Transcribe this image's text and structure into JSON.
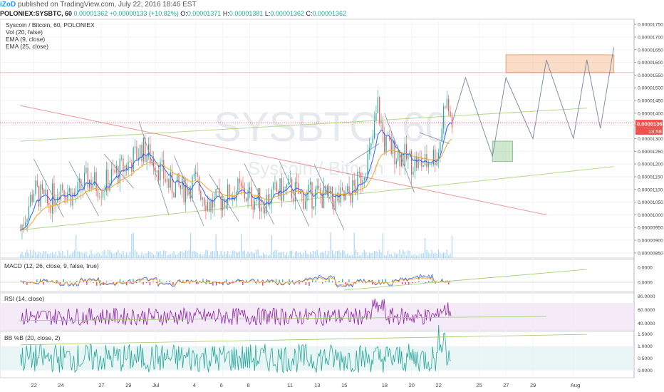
{
  "header": {
    "brand": "iZoD",
    "published": "published on TradingView.com, July 22, 2016 18:46 EST"
  },
  "quote": {
    "symbol": "POLONIEX:SYSBTC, 60",
    "last": "0.00001362",
    "change": "+0.00000133 (+10.82%)",
    "open_label": "O:",
    "open": "0.00001371",
    "high_label": "H:",
    "high": "0.00001381",
    "low_label": "L:",
    "low": "0.00001362",
    "close_label": "C:",
    "close": "0.00001362"
  },
  "legend": {
    "title": "Syscoin / Bitcoin, 60, POLONIEX",
    "vol": "Vol (20, false)",
    "ema9": "EMA (9, close)",
    "ema25": "EMA (25, close)"
  },
  "watermark": {
    "symbol": "SYSBTC, 60",
    "name": "Syscoin / Bitcoin"
  },
  "price_badge": {
    "price": "0.00001362",
    "countdown": "13:58"
  },
  "panes": {
    "macd": "MACD (12, 26, close, 9, false, true)",
    "rsi": "RSI (14, close)",
    "bb": "BB %B (20, close, 2)"
  },
  "colors": {
    "candle_up": "#26a69a",
    "candle_down": "#ef5350",
    "ema9": "#2962ff",
    "ema25": "#f6a623",
    "projection": "#7e8ea8",
    "channel_green": "#9ccc65",
    "channel_red": "#e57373",
    "target_box": "#f4b183",
    "support_box": "#a5d6a7",
    "rsi": "#8e24aa",
    "bb": "#26a69a"
  },
  "chart_data": {
    "type": "line",
    "symbol": "POLONIEX:SYSBTC",
    "interval": "60",
    "x_tick_labels": [
      "22",
      "24",
      "27",
      "29",
      "Jul",
      "4",
      "6",
      "8",
      "11",
      "13",
      "15",
      "18",
      "20",
      "22",
      "25",
      "27",
      "29",
      "Aug"
    ],
    "price_axis": {
      "ticks": [
        "0.00001750",
        "0.00001700",
        "0.00001650",
        "0.00001600",
        "0.00001550",
        "0.00001500",
        "0.00001450",
        "0.00001400",
        "0.00001350",
        "0.00001300",
        "0.00001250",
        "0.00001200",
        "0.00001150",
        "0.00001100",
        "0.00001050",
        "0.00001000",
        "0.00000950",
        "0.00000900",
        "0.00000850"
      ],
      "ylim": [
        8.3e-06,
        1.77e-05
      ]
    },
    "price_series": [
      {
        "day": 21,
        "close": 9.4e-06
      },
      {
        "day": 22,
        "close": 1.1e-05
      },
      {
        "day": 23,
        "close": 1.04e-05
      },
      {
        "day": 24,
        "close": 1.12e-05
      },
      {
        "day": 25,
        "close": 1.07e-05
      },
      {
        "day": 26,
        "close": 1.14e-05
      },
      {
        "day": 27,
        "close": 1.11e-05
      },
      {
        "day": 28,
        "close": 1.16e-05
      },
      {
        "day": 29,
        "close": 1.2e-05
      },
      {
        "day": 30,
        "close": 1.26e-05
      },
      {
        "day": 31,
        "close": 1.21e-05
      },
      {
        "day": 32,
        "close": 1.12e-05
      },
      {
        "day": 33,
        "close": 1.1e-05
      },
      {
        "day": 34,
        "close": 1.13e-05
      },
      {
        "day": 35,
        "close": 1.04e-05
      },
      {
        "day": 36,
        "close": 1.06e-05
      },
      {
        "day": 37,
        "close": 1.1e-05
      },
      {
        "day": 38,
        "close": 1.07e-05
      },
      {
        "day": 39,
        "close": 1.05e-05
      },
      {
        "day": 40,
        "close": 1.09e-05
      },
      {
        "day": 41,
        "close": 1.1e-05
      },
      {
        "day": 42,
        "close": 1.07e-05
      },
      {
        "day": 43,
        "close": 1.08e-05
      },
      {
        "day": 44,
        "close": 1.06e-05
      },
      {
        "day": 45,
        "close": 1.06e-05
      },
      {
        "day": 46,
        "close": 1.12e-05
      },
      {
        "day": 47,
        "close": 1.25e-05
      },
      {
        "day": 47.5,
        "close": 1.43e-05
      },
      {
        "day": 48,
        "close": 1.28e-05
      },
      {
        "day": 49,
        "close": 1.24e-05
      },
      {
        "day": 50,
        "close": 1.21e-05
      },
      {
        "day": 51,
        "close": 1.2e-05
      },
      {
        "day": 52,
        "close": 1.25e-05
      },
      {
        "day": 52.5,
        "close": 1.46e-05
      },
      {
        "day": 53,
        "close": 1.36e-05
      }
    ],
    "projection_path": [
      {
        "day": 53,
        "price": 1.36e-05
      },
      {
        "day": 54,
        "price": 1.54e-05
      },
      {
        "day": 56,
        "price": 1.23e-05
      },
      {
        "day": 57,
        "price": 1.54e-05
      },
      {
        "day": 59,
        "price": 1.3e-05
      },
      {
        "day": 60,
        "price": 1.61e-05
      },
      {
        "day": 62,
        "price": 1.3e-05
      },
      {
        "day": 63,
        "price": 1.61e-05
      },
      {
        "day": 64,
        "price": 1.34e-05
      },
      {
        "day": 65,
        "price": 1.66e-05
      }
    ],
    "zones": {
      "target": {
        "from_day": 57,
        "to_day": 65,
        "low": 1.56e-05,
        "high": 1.63e-05
      },
      "support": {
        "from_day": 56,
        "to_day": 57.5,
        "low": 1.21e-05,
        "high": 1.29e-05
      }
    },
    "channel_lines": [
      {
        "name": "lower-trend",
        "from_day": 21,
        "from_price": 9.4e-06,
        "to_day": 65,
        "to_price": 1.19e-05
      },
      {
        "name": "upper-trend",
        "from_day": 21,
        "from_price": 1.29e-05,
        "to_day": 63,
        "to_price": 1.42e-05
      },
      {
        "name": "resistance-descending",
        "from_day": 21,
        "from_price": 1.43e-05,
        "to_day": 60,
        "to_price": 1e-05
      }
    ],
    "last_price": 1.362e-05,
    "macd": {
      "ticks": [
        "0.0000",
        "0.0000"
      ],
      "values": [
        0,
        0.2,
        -0.3,
        0.4,
        -0.2,
        0.1,
        0.5,
        -0.4,
        0.2,
        0.0,
        -0.1,
        0.3,
        0.1,
        -0.2,
        0.4,
        0.9,
        -0.5,
        0.2,
        -0.3,
        0.6,
        1.0,
        0.3
      ]
    },
    "rsi": {
      "ticks": [
        "80.0000",
        "60.0000",
        "40.0000"
      ],
      "band": [
        30,
        70
      ],
      "ylim": [
        30,
        85
      ]
    },
    "bb": {
      "ticks": [
        "1.5000",
        "1.0000",
        "0.5000",
        "0.0000"
      ],
      "band": [
        0,
        1
      ],
      "ylim": [
        -0.3,
        1.6
      ]
    }
  }
}
